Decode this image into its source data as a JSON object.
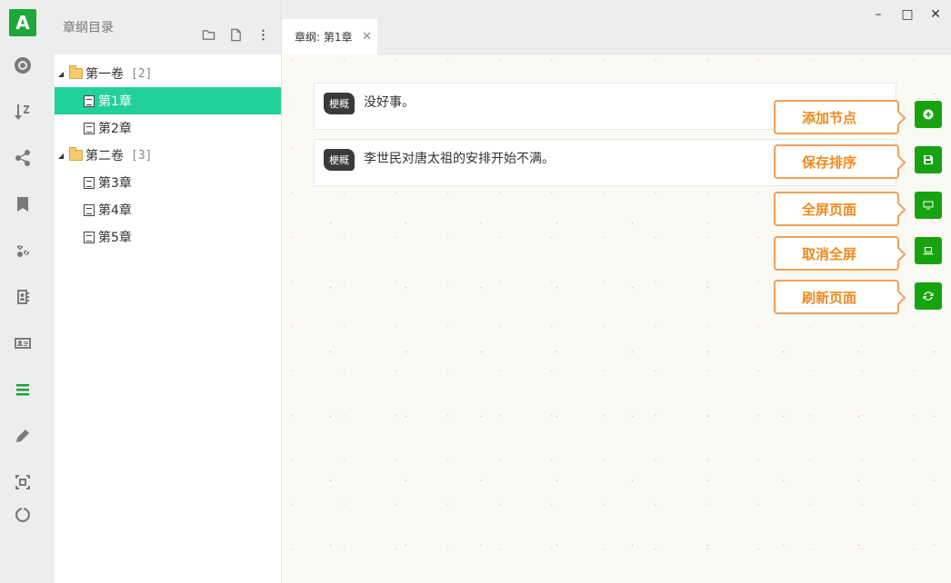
{
  "app": {
    "logo_text": "A",
    "accent_color": "#1fa83a",
    "selected_color": "#21d09a"
  },
  "rail": {
    "items": [
      {
        "name": "lifebuoy-icon"
      },
      {
        "name": "sort-alpha-icon"
      },
      {
        "name": "share-icon"
      },
      {
        "name": "bookmark-icon"
      },
      {
        "name": "gears-icon"
      },
      {
        "name": "contacts-icon"
      },
      {
        "name": "id-card-icon"
      },
      {
        "name": "list-icon",
        "active": true
      },
      {
        "name": "pencil-icon"
      },
      {
        "name": "frame-icon"
      },
      {
        "name": "power-icon"
      }
    ]
  },
  "tree": {
    "title": "章纲目录",
    "actions": [
      "folder-icon",
      "file-icon",
      "more-icon"
    ],
    "volumes": [
      {
        "label": "第一卷",
        "count": "[2]",
        "chapters": [
          "第1章",
          "第2章"
        ]
      },
      {
        "label": "第二卷",
        "count": "[3]",
        "chapters": [
          "第3章",
          "第4章",
          "第5章"
        ]
      }
    ],
    "selected": "第1章"
  },
  "tabs": [
    {
      "label": "章纲: 第1章"
    }
  ],
  "window": {
    "minimize": "–",
    "maximize": "□",
    "close": "✕"
  },
  "cards": [
    {
      "tag": "梗概",
      "text": "没好事。"
    },
    {
      "tag": "梗概",
      "text": "李世民对唐太祖的安排开始不满。"
    }
  ],
  "actions": [
    {
      "label": "添加节点",
      "icon": "plus-circle-icon"
    },
    {
      "label": "保存排序",
      "icon": "save-icon"
    },
    {
      "label": "全屏页面",
      "icon": "monitor-icon"
    },
    {
      "label": "取消全屏",
      "icon": "laptop-icon"
    },
    {
      "label": "刷新页面",
      "icon": "refresh-icon"
    }
  ]
}
